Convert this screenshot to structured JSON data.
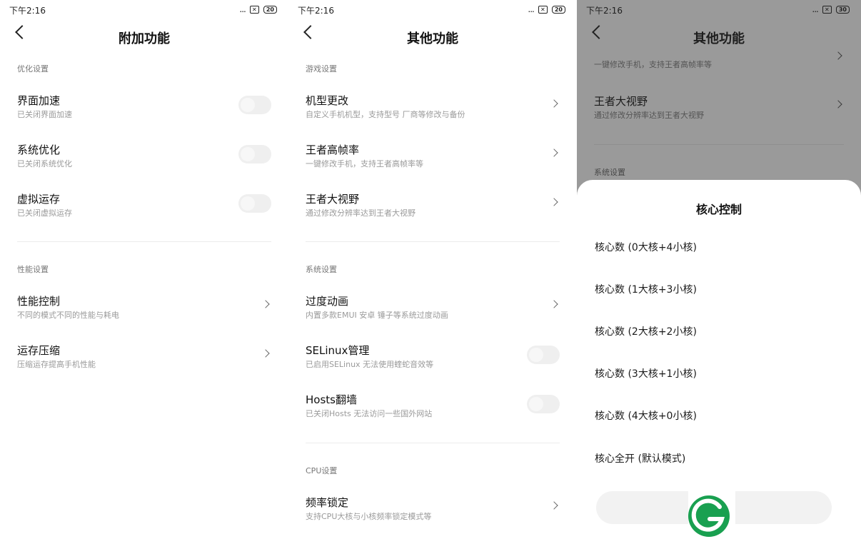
{
  "status": {
    "time": "下午2:16",
    "dots": "...",
    "sim": "✕",
    "battery": "20",
    "battery3": "30"
  },
  "screen1": {
    "title": "附加功能",
    "section1": "优化设置",
    "items1": [
      {
        "title": "界面加速",
        "sub": "已关闭界面加速"
      },
      {
        "title": "系统优化",
        "sub": "已关闭系统优化"
      },
      {
        "title": "虚拟运存",
        "sub": "已关闭虚拟运存"
      }
    ],
    "section2": "性能设置",
    "items2": [
      {
        "title": "性能控制",
        "sub": "不同的模式不同的性能与耗电"
      },
      {
        "title": "运存压缩",
        "sub": "压缩运存提高手机性能"
      }
    ]
  },
  "screen2": {
    "title": "其他功能",
    "section1": "游戏设置",
    "items1": [
      {
        "title": "机型更改",
        "sub": "自定义手机机型，支持型号 厂商等修改与备份"
      },
      {
        "title": "王者高帧率",
        "sub": "一键修改手机，支持王者高帧率等"
      },
      {
        "title": "王者大视野",
        "sub": "通过修改分辨率达到王者大视野"
      }
    ],
    "section2": "系统设置",
    "items2": [
      {
        "title": "过度动画",
        "sub": "内置多款EMUI 安卓 锤子等系统过度动画"
      },
      {
        "title": "SELinux管理",
        "sub": "已启用SELinux 无法使用蝰蛇音效等"
      },
      {
        "title": "Hosts翻墙",
        "sub": "已关闭Hosts 无法访问一些国外网站"
      }
    ],
    "section3": "CPU设置",
    "items3": [
      {
        "title": "频率锁定",
        "sub": "支持CPU大核与小核频率锁定模式等"
      }
    ]
  },
  "screen3": {
    "title": "其他功能",
    "partial_sub": "一键修改手机，支持王者高帧率等",
    "item": {
      "title": "王者大视野",
      "sub": "通过修改分辨率达到王者大视野"
    },
    "section": "系统设置",
    "sheet": {
      "title": "核心控制",
      "options": [
        "核心数 (0大核+4小核)",
        "核心数 (1大核+3小核)",
        "核心数 (2大核+2小核)",
        "核心数 (3大核+1小核)",
        "核心数 (4大核+0小核)",
        "核心全开 (默认模式)"
      ]
    }
  },
  "colors": {
    "accent_green": "#19a050",
    "scrim": "#9a9a9a",
    "toggle_off": "#efefef"
  },
  "icons": [
    "back-arrow-icon",
    "chevron-right-icon",
    "toggle-switch",
    "more-dots-icon",
    "sim-icon",
    "battery-icon",
    "brand-logo"
  ]
}
